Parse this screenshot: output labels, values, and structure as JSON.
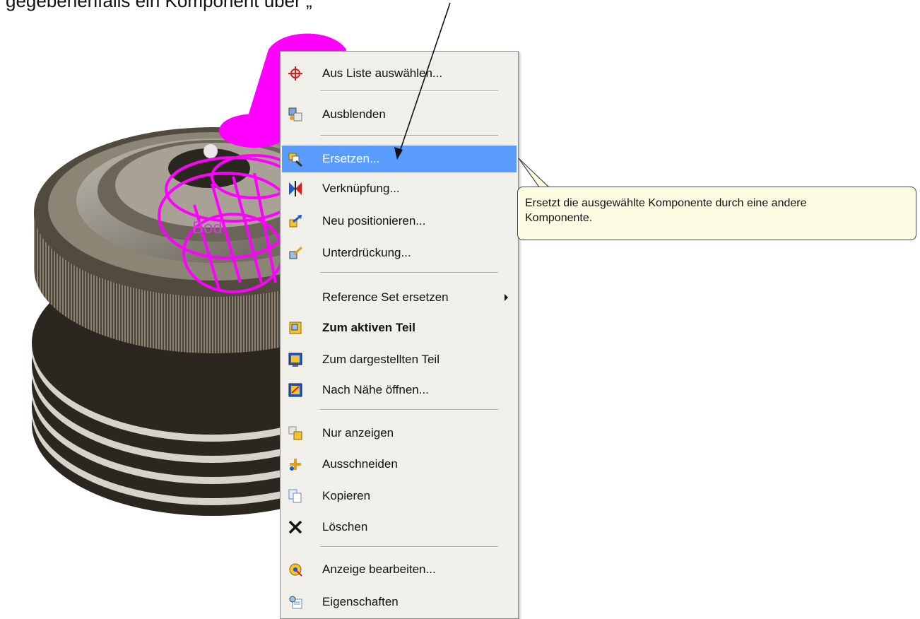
{
  "caption": "gegebenenfalls ein Komponent über „",
  "menu": {
    "items": [
      {
        "label": "Aus Liste auswählen...",
        "icon": "crosshair-icon"
      },
      {
        "label": "Ausblenden",
        "icon": "hide-icon"
      },
      {
        "label": "Ersetzen...",
        "icon": "replace-icon",
        "highlighted": true
      },
      {
        "label": "Verknüpfung...",
        "icon": "constraint-icon"
      },
      {
        "label": "Neu positionieren...",
        "icon": "reposition-icon"
      },
      {
        "label": "Unterdrückung...",
        "icon": "suppress-icon"
      },
      {
        "label": "Reference Set ersetzen",
        "icon": "none",
        "submenu": true
      },
      {
        "label": "Zum aktiven Teil",
        "icon": "work-part-icon",
        "bold": true
      },
      {
        "label": "Zum dargestellten Teil",
        "icon": "displayed-part-icon"
      },
      {
        "label": "Nach Nähe öffnen...",
        "icon": "open-by-proximity-icon"
      },
      {
        "label": "Nur anzeigen",
        "icon": "show-only-icon"
      },
      {
        "label": "Ausschneiden",
        "icon": "cut-icon"
      },
      {
        "label": "Kopieren",
        "icon": "copy-icon"
      },
      {
        "label": "Löschen",
        "icon": "delete-icon"
      },
      {
        "label": "Anzeige bearbeiten...",
        "icon": "edit-display-icon"
      },
      {
        "label": "Eigenschaften",
        "icon": "properties-icon"
      }
    ]
  },
  "tooltip": {
    "line1": "Ersetzt die ausgewählte Komponente durch eine andere",
    "line2": "Komponente."
  },
  "scene": {
    "label": "Bod",
    "highlight_color": "#ff00ff"
  },
  "colors": {
    "highlight": "#5b9cff",
    "menu_bg": "#f0efea",
    "tooltip_bg": "#fdfde3"
  }
}
